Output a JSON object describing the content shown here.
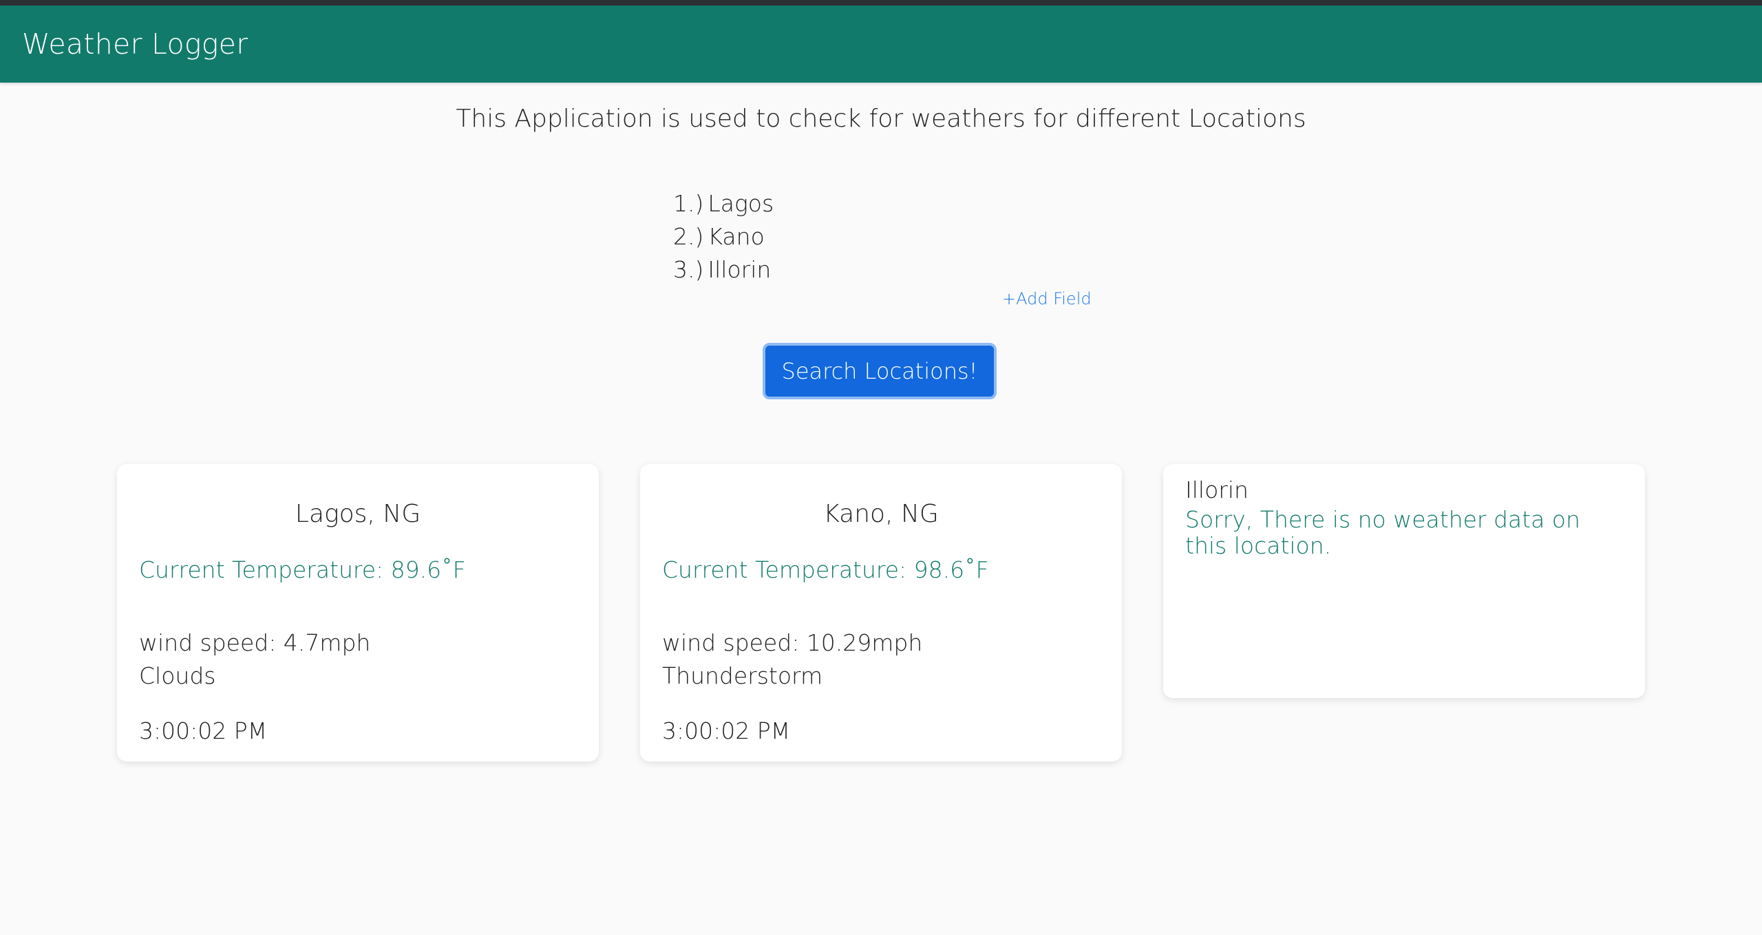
{
  "app": {
    "title": "Weather Logger"
  },
  "intro": "This Application is used to check for weathers for different Locations",
  "locations": [
    {
      "num": "1.)",
      "name": "Lagos"
    },
    {
      "num": "2.)",
      "name": "Kano"
    },
    {
      "num": "3.)",
      "name": "Illorin"
    }
  ],
  "add_field_label": "+Add Field",
  "search_button_label": "Search Locations!",
  "cards": [
    {
      "city": "Lagos, NG",
      "temperature": "Current Temperature: 89.6˚F",
      "wind": "wind speed: 4.7mph",
      "condition": "Clouds",
      "time": "3:00:02 PM"
    },
    {
      "city": "Kano, NG",
      "temperature": "Current Temperature: 98.6˚F",
      "wind": "wind speed: 10.29mph",
      "condition": "Thunderstorm",
      "time": "3:00:02 PM"
    }
  ],
  "error_card": {
    "city": "Illorin",
    "message": "Sorry, There is no weather data on this location."
  },
  "colors": {
    "appbar": "#127a6b",
    "accent_text": "#127a6b",
    "button": "#1268dc",
    "link": "#1e7ae0"
  }
}
